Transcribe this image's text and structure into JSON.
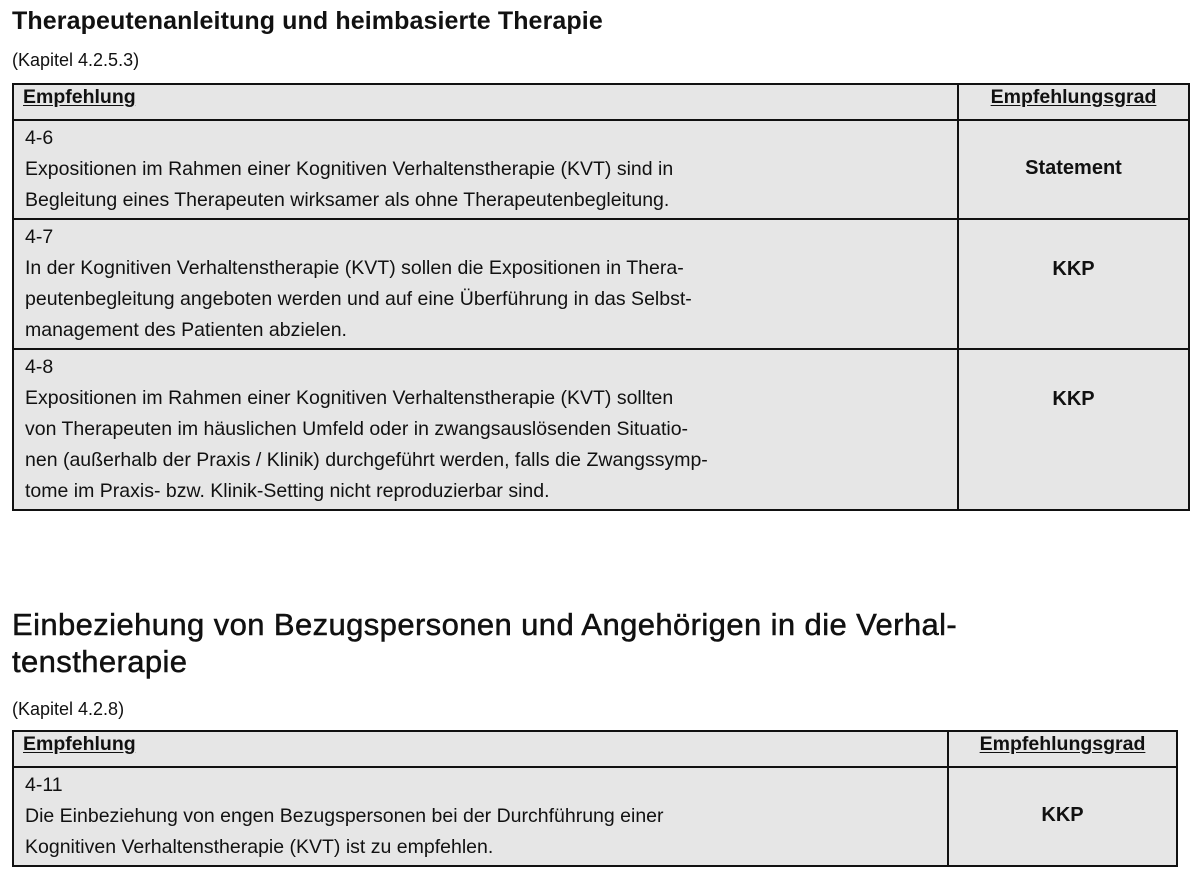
{
  "section1": {
    "title": "Therapeutenanleitung und heimbasierte Therapie",
    "chapter_ref": "(Kapitel 4.2.5.3)",
    "table": {
      "col_recommendation": "Empfehlung",
      "col_grade": "Empfehlungsgrad",
      "rows": [
        {
          "id": "4-6",
          "text_lines": [
            "Expositionen im Rahmen einer Kognitiven Verhaltenstherapie (KVT) sind in",
            "Begleitung eines Therapeuten wirksamer als ohne Therapeutenbegleitung."
          ],
          "grade": "Statement"
        },
        {
          "id": "4-7",
          "text_lines": [
            "In der Kognitiven Verhaltenstherapie (KVT) sollen die Expositionen in Thera-",
            "peutenbegleitung angeboten werden und auf eine Überführung in das Selbst-",
            "management des Patienten abzielen."
          ],
          "grade": "KKP"
        },
        {
          "id": "4-8",
          "text_lines": [
            "Expositionen im Rahmen einer Kognitiven Verhaltenstherapie (KVT) sollten",
            "von Therapeuten im häuslichen Umfeld oder in zwangsauslösenden Situatio-",
            "nen (außerhalb der Praxis / Klinik) durchgeführt werden, falls die Zwangssymp-",
            "tome im Praxis- bzw. Klinik-Setting nicht reproduzierbar sind."
          ],
          "grade": "KKP"
        }
      ]
    }
  },
  "section2": {
    "title_lines": [
      "Einbeziehung von Bezugspersonen und Angehörigen in die Verhal-",
      "tenstherapie"
    ],
    "chapter_ref": "(Kapitel 4.2.8)",
    "table": {
      "col_recommendation": "Empfehlung",
      "col_grade": "Empfehlungsgrad",
      "rows": [
        {
          "id": "4-11",
          "text_lines": [
            "Die Einbeziehung von engen Bezugspersonen bei der Durchführung einer",
            "Kognitiven Verhaltenstherapie (KVT) ist zu empfehlen."
          ],
          "grade": "KKP"
        }
      ]
    }
  }
}
